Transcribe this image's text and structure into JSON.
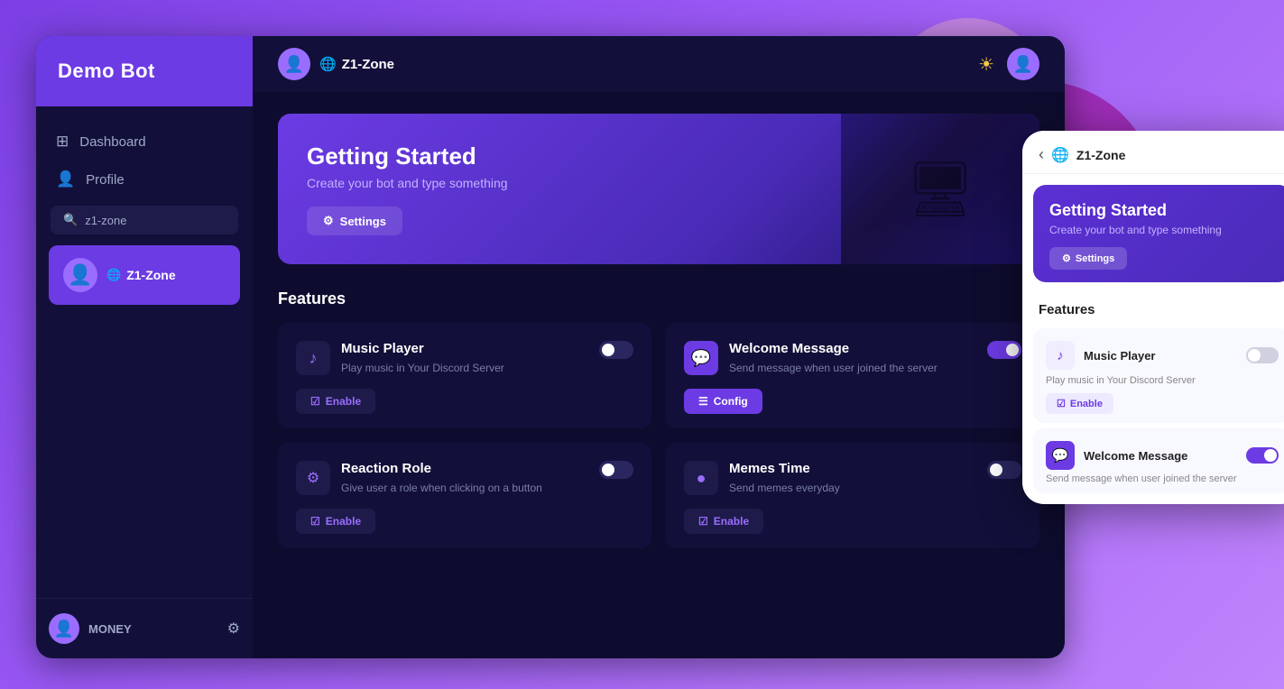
{
  "app": {
    "title": "Demo Bot",
    "brand": "Demo Bot"
  },
  "sidebar": {
    "nav": [
      {
        "id": "dashboard",
        "label": "Dashboard",
        "icon": "⊞"
      },
      {
        "id": "profile",
        "label": "Profile",
        "icon": "👤"
      }
    ],
    "search": {
      "placeholder": "z1-zone",
      "value": "z1-zone"
    },
    "server": {
      "name": "Z1-Zone",
      "globe": "🌐"
    },
    "bottom": {
      "username": "MONEY",
      "gear": "⚙"
    }
  },
  "topbar": {
    "server_name": "Z1-Zone",
    "globe": "🌐",
    "sun": "☀",
    "avatar": "👤"
  },
  "banner": {
    "title": "Getting Started",
    "subtitle": "Create your bot and type something",
    "settings_label": "Settings",
    "image_icon": "🖥"
  },
  "features": {
    "section_title": "Features",
    "cards": [
      {
        "id": "music-player",
        "title": "Music Player",
        "description": "Play music in Your Discord Server",
        "icon": "♪",
        "icon_style": "dark",
        "toggle": "off",
        "actions": [
          {
            "id": "enable",
            "label": "Enable",
            "style": "enable"
          }
        ]
      },
      {
        "id": "welcome-message",
        "title": "Welcome Message",
        "description": "Send message when user joined the server",
        "icon": "💬",
        "icon_style": "purple",
        "toggle": "on",
        "actions": [
          {
            "id": "config",
            "label": "Config",
            "style": "config"
          }
        ]
      },
      {
        "id": "reaction-role",
        "title": "Reaction Role",
        "description": "Give user a role when clicking on a button",
        "icon": "⚙",
        "icon_style": "dark",
        "toggle": "off",
        "actions": [
          {
            "id": "enable",
            "label": "Enable",
            "style": "enable"
          }
        ]
      },
      {
        "id": "memes-time",
        "title": "Memes Time",
        "description": "Send memes everyday",
        "icon": "●",
        "icon_style": "dark",
        "toggle": "off",
        "actions": [
          {
            "id": "enable",
            "label": "Enable",
            "style": "enable"
          }
        ]
      }
    ]
  },
  "mobile": {
    "server_name": "Z1-Zone",
    "banner": {
      "title": "Getting Started",
      "subtitle": "Create your bot and type something",
      "settings_label": "Settings"
    },
    "section_title": "Features",
    "music_player": {
      "title": "Music Player",
      "description": "Play music in Your Discord Server",
      "toggle": "off",
      "enable_label": "Enable"
    },
    "welcome_message": {
      "title": "Welcome Message",
      "description": "Send message when user joined the server",
      "toggle": "on"
    }
  },
  "decorative_circles": {
    "circle1": {
      "color": "#e040fb"
    },
    "circle2": {
      "color": "#9c27b0"
    }
  }
}
